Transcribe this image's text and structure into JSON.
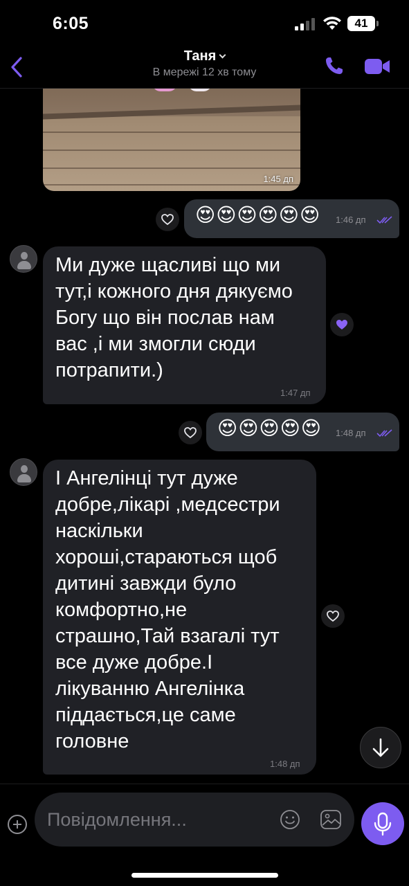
{
  "status_bar": {
    "time": "6:05",
    "battery": "41"
  },
  "header": {
    "contact_name": "Таня",
    "presence": "В мережі 12 хв тому",
    "accent_color": "#7d5cf0"
  },
  "messages": [
    {
      "type": "image",
      "direction": "in",
      "time": "1:45 дп"
    },
    {
      "type": "emoji",
      "direction": "out",
      "text": "😍😍😍😍😍😍",
      "time": "1:46 дп",
      "status": "read"
    },
    {
      "type": "text",
      "direction": "in",
      "lines": [
        "Ми дуже щасливі що ми",
        "тут,і кожного дня дякуємо",
        "Богу що він послав нам",
        "вас ,і ми змогли сюди",
        "потрапити.)"
      ],
      "time": "1:47 дп",
      "reaction": "purple-heart"
    },
    {
      "type": "emoji",
      "direction": "out",
      "text": "😍😍😍😍😍",
      "time": "1:48 дп",
      "status": "read"
    },
    {
      "type": "text",
      "direction": "in",
      "lines": [
        "І Ангелінці тут дуже",
        "добре,лікарі ,медсестри",
        "наскільки",
        "хороші,стараються щоб",
        "дитині завжди було",
        "комфортно,не",
        "страшно,Тай взагалі тут",
        "все дуже добре.І",
        "лікуванню Ангелінка",
        "піддається,це саме",
        "головне"
      ],
      "time": "1:48 дп"
    }
  ],
  "composer": {
    "placeholder": "Повідомлення..."
  },
  "icons": {
    "back": "chevron-left-icon",
    "call": "phone-icon",
    "video": "video-camera-icon",
    "react": "heart-outline-icon",
    "scroll": "arrow-down-icon",
    "attach": "plus-icon",
    "sticker": "smiley-icon",
    "gallery": "image-icon",
    "mic": "microphone-icon"
  }
}
